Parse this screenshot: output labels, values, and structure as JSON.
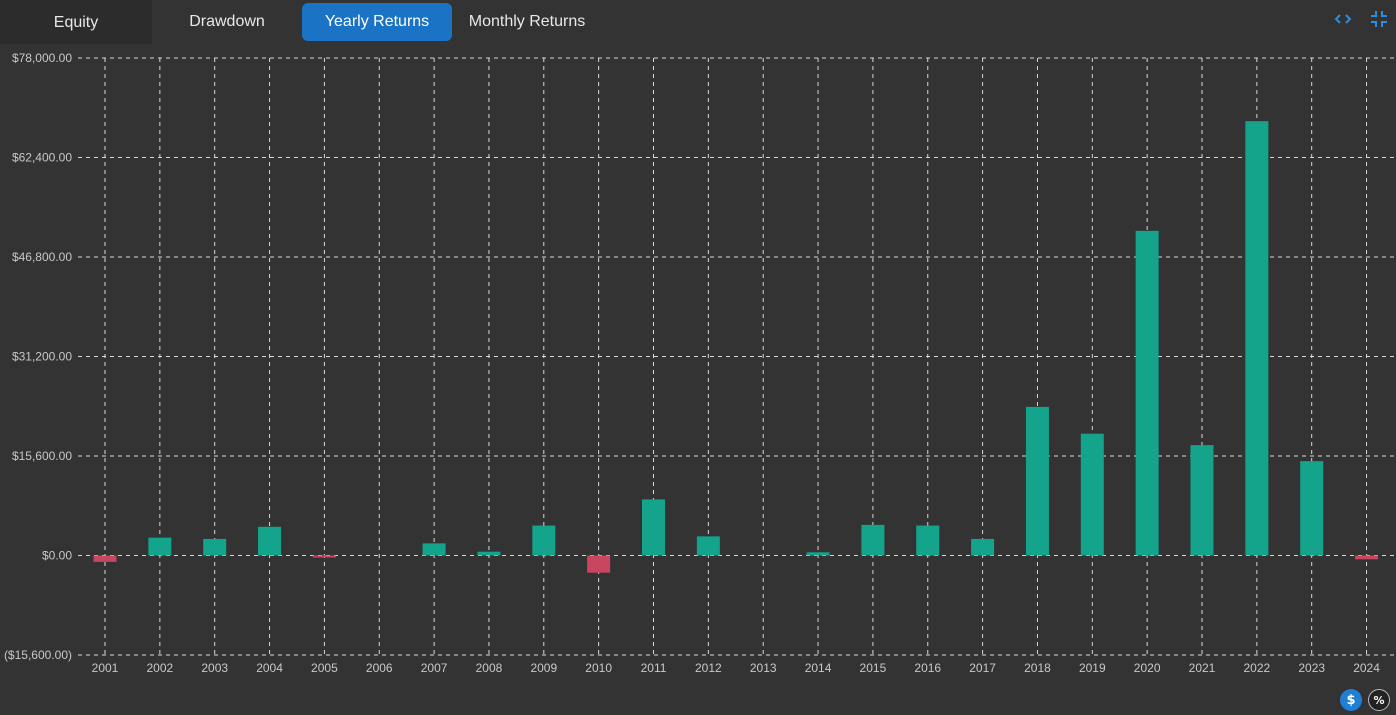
{
  "tabs": [
    {
      "label": "Equity",
      "active": false
    },
    {
      "label": "Drawdown",
      "active": false
    },
    {
      "label": "Yearly Returns",
      "active": true
    },
    {
      "label": "Monthly Returns",
      "active": false
    }
  ],
  "toolbar": {
    "icons": [
      "code-icon",
      "compress-icon"
    ]
  },
  "view_toggles": {
    "dollar_label": "$",
    "percent_label": "%",
    "selected": "dollar"
  },
  "colors": {
    "positive": "#14a38b",
    "negative": "#c8465e",
    "grid": "#d8d8d8",
    "accent": "#1a73c4"
  },
  "chart_data": {
    "type": "bar",
    "categories": [
      "2001",
      "2002",
      "2003",
      "2004",
      "2005",
      "2006",
      "2007",
      "2008",
      "2009",
      "2010",
      "2011",
      "2012",
      "2013",
      "2014",
      "2015",
      "2016",
      "2017",
      "2018",
      "2019",
      "2020",
      "2021",
      "2022",
      "2023",
      "2024"
    ],
    "values": [
      -1000,
      2800,
      2600,
      4500,
      -200,
      0,
      1900,
      600,
      4700,
      -2700,
      8800,
      3000,
      0,
      500,
      4800,
      4700,
      2600,
      23300,
      19100,
      50900,
      17300,
      68100,
      14800,
      -600
    ],
    "ylim": [
      -15600,
      78000
    ],
    "yticks": [
      "$78,000.00",
      "$62,400.00",
      "$46,800.00",
      "$31,200.00",
      "$15,600.00",
      "$0.00",
      "($15,600.00)"
    ],
    "ytick_values": [
      78000,
      62400,
      46800,
      31200,
      15600,
      0,
      -15600
    ],
    "grid": true,
    "grid_style": "dashed"
  }
}
